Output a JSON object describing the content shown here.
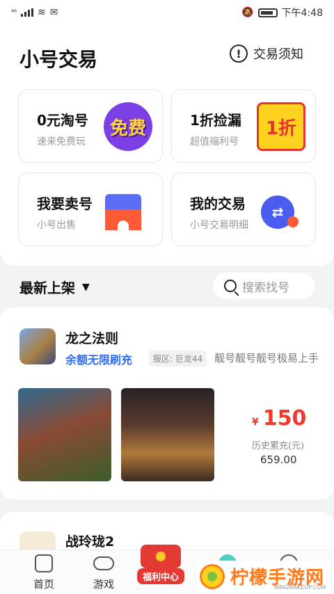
{
  "status_bar": {
    "signal_text": "⁴⁶",
    "time": "下午4:48"
  },
  "header": {
    "title": "小号交易",
    "notice_label": "交易须知"
  },
  "cards": [
    {
      "title": "0元淘号",
      "subtitle": "速来免费玩",
      "art_text": "免费"
    },
    {
      "title": "1折捡漏",
      "subtitle": "超值福利号",
      "art_text": "1折"
    },
    {
      "title": "我要卖号",
      "subtitle": "小号出售"
    },
    {
      "title": "我的交易",
      "subtitle": "小号交易明细"
    }
  ],
  "list": {
    "section_title": "最新上架",
    "search_placeholder": "搜索找号"
  },
  "listings": [
    {
      "game_name": "龙之法则",
      "highlight_tag": "余额无限刷充",
      "server_tag": "服区: 巨龙44",
      "description": "靓号靓号靓号极易上手",
      "currency": "¥",
      "price": "150",
      "recharge_label": "历史累充(元)",
      "recharge_value": "659.00"
    },
    {
      "game_name": "战玲珑2"
    }
  ],
  "tabbar": {
    "home": "首页",
    "games": "游戏",
    "welfare": "福利中心"
  },
  "brand": {
    "name": "柠檬手游网",
    "url": "NINGMAKEUP.COM"
  },
  "colors": {
    "accent_blue": "#2f6df6",
    "price_red": "#ef3b2d",
    "brand_orange": "#ff7a1a"
  }
}
